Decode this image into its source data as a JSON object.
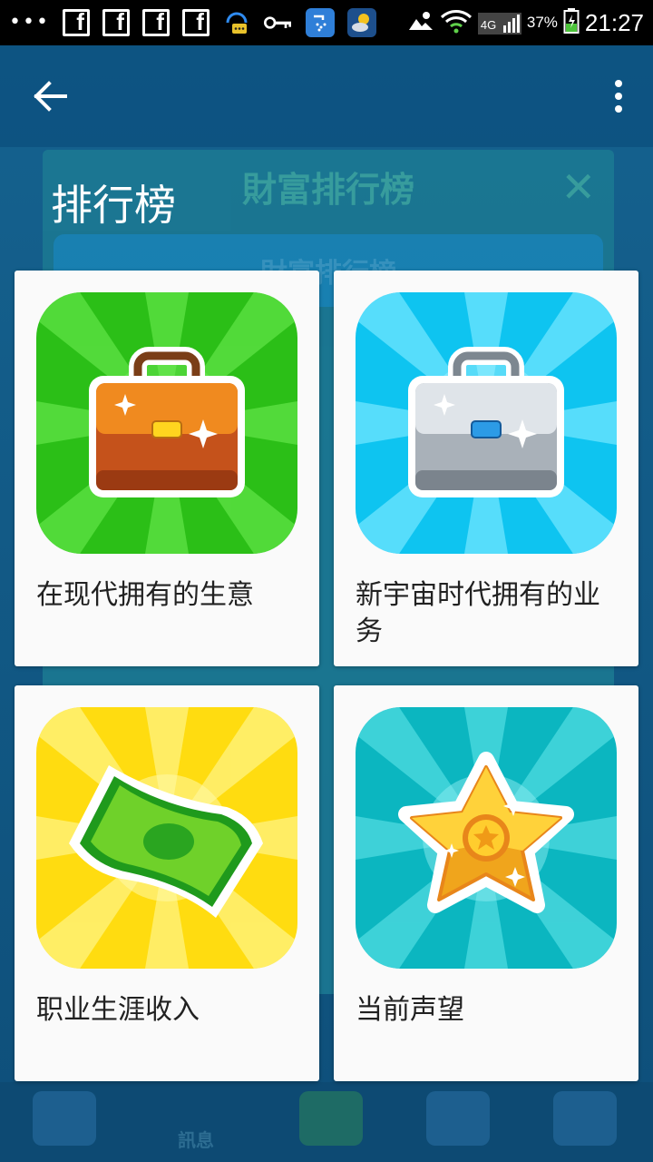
{
  "status_bar": {
    "overflow": "•••",
    "fb_letter": "f",
    "network": "4G",
    "battery": "37%",
    "time": "21:27"
  },
  "background": {
    "panel_title": "財富排行榜",
    "panel_subtitle": "財富排行榜",
    "nav_label": "訊息"
  },
  "toolbar": {
    "back_icon": "arrow-left-icon",
    "overflow_icon": "more-vertical-icon"
  },
  "page_title": "排行榜",
  "cards": [
    {
      "label": "在现代拥有的生意",
      "icon": "orange-briefcase-icon",
      "bg": "#2fc71f"
    },
    {
      "label": "新宇宙时代拥有的业务",
      "icon": "silver-briefcase-icon",
      "bg": "#16c9f2"
    },
    {
      "label": "职业生涯收入",
      "icon": "money-bill-icon",
      "bg": "#ffe01a"
    },
    {
      "label": "当前声望",
      "icon": "gold-star-icon",
      "bg": "#10bec6"
    }
  ],
  "colors": {
    "toolbar": "#0b4f7e",
    "card_bg": "#fafafa",
    "card_text": "#212121"
  }
}
